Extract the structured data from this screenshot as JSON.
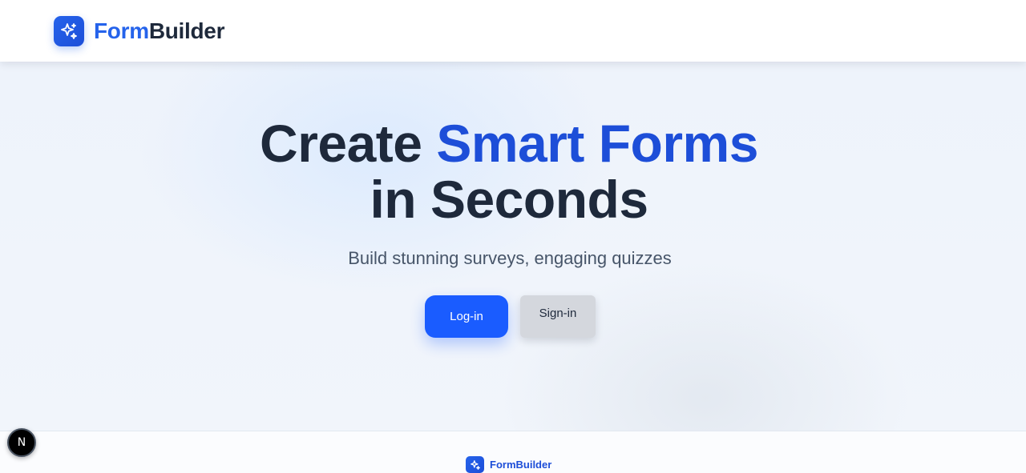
{
  "header": {
    "brand_accent": "Form",
    "brand_rest": "Builder",
    "logo_icon": "sparkles-icon"
  },
  "hero": {
    "headline_part1": "Create ",
    "headline_accent": "Smart Forms",
    "headline_part2": "in Seconds",
    "subtitle": "Build stunning surveys, engaging quizzes",
    "login_label": "Log-in",
    "signin_label": "Sign-in"
  },
  "footer": {
    "brand": "FormBuilder",
    "logo_icon": "sparkles-icon"
  },
  "dev_badge": {
    "label": "N",
    "icon": "nextjs-icon"
  },
  "colors": {
    "accent": "#1d4ed8",
    "primary_button": "#1a5cff",
    "secondary_button": "#d4d7dd",
    "text_dark": "#1e293b"
  }
}
